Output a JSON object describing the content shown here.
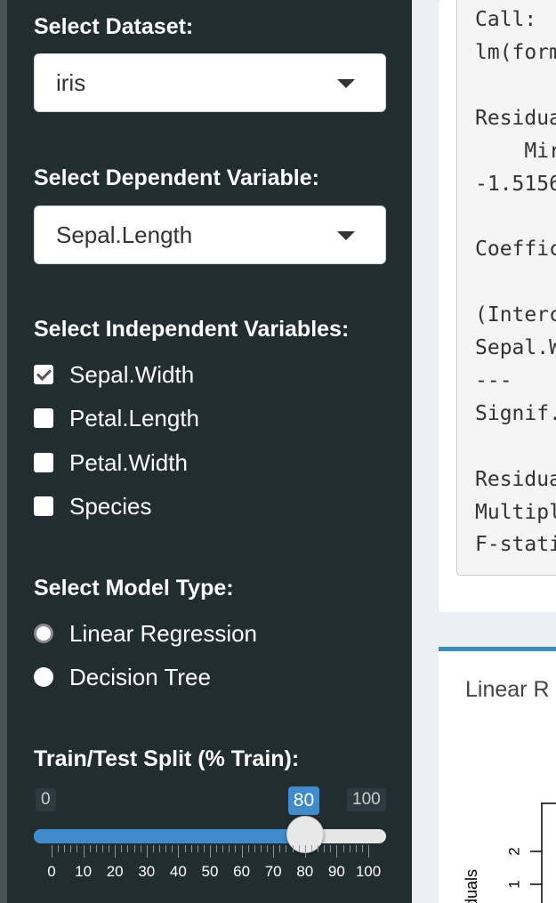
{
  "sidebar": {
    "dataset": {
      "label": "Select Dataset:",
      "value": "iris"
    },
    "dependent": {
      "label": "Select Dependent Variable:",
      "value": "Sepal.Length"
    },
    "independent": {
      "label": "Select Independent Variables:",
      "options": [
        {
          "label": "Sepal.Width",
          "checked": true
        },
        {
          "label": "Petal.Length",
          "checked": false
        },
        {
          "label": "Petal.Width",
          "checked": false
        },
        {
          "label": "Species",
          "checked": false
        }
      ]
    },
    "model_type": {
      "label": "Select Model Type:",
      "options": [
        {
          "label": "Linear Regression",
          "selected": true
        },
        {
          "label": "Decision Tree",
          "selected": false
        }
      ]
    },
    "split": {
      "label": "Train/Test Split (% Train):",
      "min": "0",
      "max": "100",
      "value": "80",
      "value_number": 80,
      "tick_labels": [
        "0",
        "10",
        "20",
        "30",
        "40",
        "50",
        "60",
        "70",
        "80",
        "90",
        "100"
      ]
    }
  },
  "main": {
    "summary_lines": [
      "Call:",
      "lm(form",
      "",
      "Residua",
      "    Mir",
      "-1.5156",
      "",
      "Coeffic",
      "",
      "(Interc",
      "Sepal.W",
      "---",
      "Signif.",
      "",
      "Residua",
      "Multipl",
      "F-stati"
    ],
    "plot": {
      "title": "Linear R",
      "y_axis_label": "duals",
      "y_ticks": [
        "2",
        "1"
      ]
    }
  },
  "colors": {
    "sidebar_bg": "#222d32",
    "accent": "#428bca",
    "box_header": "#3c8dbc"
  }
}
